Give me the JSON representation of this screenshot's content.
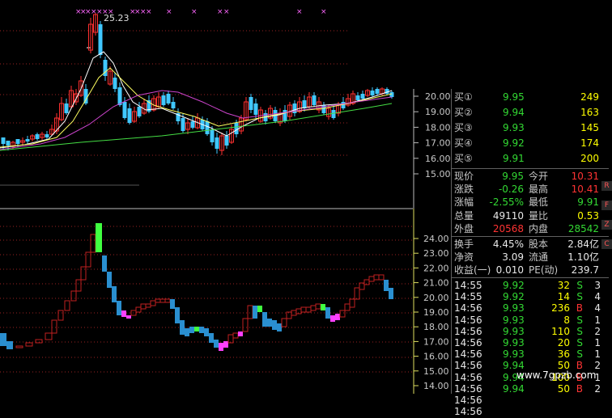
{
  "upper": {
    "peak_label": "25.23",
    "axis": [
      "20.00",
      "19.00",
      "18.00",
      "17.00",
      "16.00",
      "15.00"
    ]
  },
  "lower": {
    "axis": [
      "24.00",
      "23.00",
      "22.00",
      "21.00",
      "20.00",
      "19.00",
      "18.00",
      "17.00",
      "16.00",
      "15.00",
      "14.00"
    ]
  },
  "quote": {
    "bids": [
      {
        "label": "买①",
        "price": "9.95",
        "vol": "249"
      },
      {
        "label": "买②",
        "price": "9.94",
        "vol": "163"
      },
      {
        "label": "买③",
        "price": "9.93",
        "vol": "145"
      },
      {
        "label": "买④",
        "price": "9.92",
        "vol": "174"
      },
      {
        "label": "买⑤",
        "price": "9.91",
        "vol": "200"
      }
    ],
    "stats": [
      {
        "l1": "现价",
        "v1": "9.95",
        "l2": "今开",
        "v2": "10.31"
      },
      {
        "l1": "涨跌",
        "v1": "-0.26",
        "l2": "最高",
        "v2": "10.41"
      },
      {
        "l1": "涨幅",
        "v1": "-2.55%",
        "l2": "最低",
        "v2": "9.91"
      },
      {
        "l1": "总量",
        "v1": "49110",
        "l2": "量比",
        "v2": "0.53"
      },
      {
        "l1": "外盘",
        "v1": "20568",
        "l2": "内盘",
        "v2": "28542"
      }
    ],
    "finance": [
      {
        "l1": "换手",
        "v1": "4.45%",
        "l2": "股本",
        "v2": "2.84亿"
      },
      {
        "l1": "净资",
        "v1": "3.09",
        "l2": "流通",
        "v2": "1.10亿"
      },
      {
        "l1": "收益(一)",
        "v1": "0.010",
        "l2": "PE(动)",
        "v2": "239.7"
      }
    ],
    "ticks": [
      {
        "time": "14:55",
        "price": "9.92",
        "vol": "32",
        "side": "S",
        "n": "3"
      },
      {
        "time": "14:55",
        "price": "9.92",
        "vol": "14",
        "side": "S",
        "n": "4"
      },
      {
        "time": "14:56",
        "price": "9.93",
        "vol": "236",
        "side": "B",
        "n": "4"
      },
      {
        "time": "14:56",
        "price": "9.93",
        "vol": "8",
        "side": "S",
        "n": "1"
      },
      {
        "time": "14:56",
        "price": "9.93",
        "vol": "110",
        "side": "S",
        "n": "2"
      },
      {
        "time": "14:56",
        "price": "9.93",
        "vol": "20",
        "side": "S",
        "n": "1"
      },
      {
        "time": "14:56",
        "price": "9.93",
        "vol": "36",
        "side": "S",
        "n": "1"
      },
      {
        "time": "14:56",
        "price": "9.94",
        "vol": "50",
        "side": "B",
        "n": "2"
      },
      {
        "time": "14:56",
        "price": "9.94",
        "vol": "100",
        "side": "B",
        "n": "1"
      },
      {
        "time": "14:56",
        "price": "9.94",
        "vol": "50",
        "side": "B",
        "n": "2"
      },
      {
        "time": "14:56",
        "price": "",
        "vol": "",
        "side": "",
        "n": ""
      },
      {
        "time": "14:56",
        "price": "",
        "vol": "",
        "side": "",
        "n": ""
      }
    ]
  },
  "side_buttons": [
    "R",
    "F",
    "Z",
    "C"
  ],
  "watermark": "www.7gpzb.com"
}
